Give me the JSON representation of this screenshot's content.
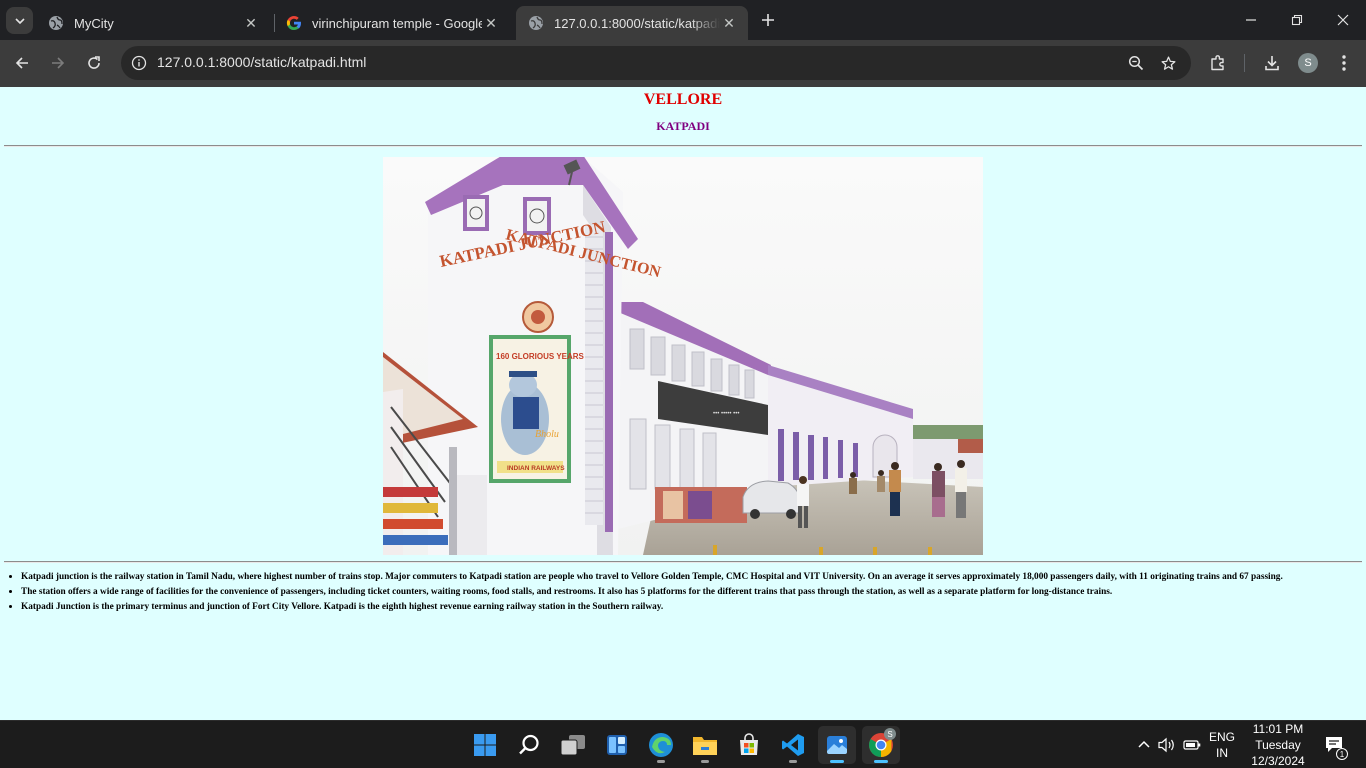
{
  "browser": {
    "tabs": [
      {
        "title": "MyCity",
        "favicon": "globe-icon"
      },
      {
        "title": "virinchipuram temple - Google",
        "favicon": "google-icon"
      },
      {
        "title": "127.0.0.1:8000/static/katpadi.html",
        "favicon": "globe-icon",
        "active": true
      }
    ],
    "url": "127.0.0.1:8000/static/katpadi.html",
    "profile_initial": "S"
  },
  "page": {
    "city": "VELLORE",
    "area": "KATPADI",
    "photo": {
      "tower_text_1": "KATPADI JUNCTION",
      "tower_text_2": "KATPADI JUNCTION",
      "poster_title": "160 GLORIOUS YEARS",
      "poster_mascot": "Bholu",
      "poster_footer": "INDIAN RAILWAYS"
    },
    "facts": [
      "Katpadi junction is the railway station in Tamil Nadu, where highest number of trains stop. Major commuters to Katpadi station are people who travel to Vellore Golden Temple, CMC Hospital and VIT University. On an average it serves approximately 18,000 passengers daily, with 11 originating trains and 67 passing.",
      "The station offers a wide range of facilities for the convenience of passengers, including ticket counters, waiting rooms, food stalls, and restrooms. It also has 5 platforms for the different trains that pass through the station, as well as a separate platform for long-distance trains.",
      "Katpadi Junction is the primary terminus and junction of Fort City Vellore. Katpadi is the eighth highest revenue earning railway station in the Southern railway."
    ],
    "colors": {
      "background": "#dfffff",
      "city": "#e00000",
      "area": "#800080"
    }
  },
  "taskbar": {
    "apps": [
      "windows-start-icon",
      "search-icon",
      "task-view-icon",
      "widgets-icon",
      "edge-icon",
      "file-explorer-icon",
      "microsoft-store-icon",
      "vscode-icon",
      "photos-icon",
      "chrome-icon"
    ],
    "lang_line1": "ENG",
    "lang_line2": "IN",
    "time": "11:01 PM",
    "day": "Tuesday",
    "date": "12/3/2024",
    "notifications": "1"
  }
}
